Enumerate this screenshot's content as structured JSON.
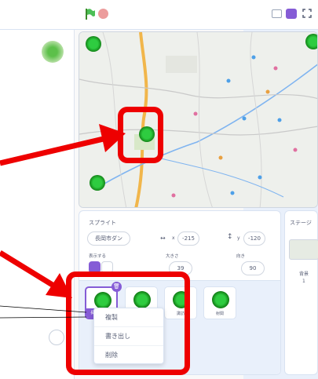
{
  "toolbar": {
    "flag": "green-flag-icon",
    "stop": "stop-icon"
  },
  "sprite_panel": {
    "section_label": "スプライト",
    "sprite_name": "長岡市ダン",
    "x_value": "-215",
    "y_value": "-120",
    "show_label": "表示する",
    "size_label": "大きさ",
    "size_value": "39",
    "direction_label": "向き",
    "direction_value": "90"
  },
  "stage_panel": {
    "title": "ステージ",
    "backdrop_label": "背景",
    "backdrop_count": "1"
  },
  "sprites": [
    {
      "label": "長岡",
      "selected": true
    },
    {
      "label": "",
      "selected": false
    },
    {
      "label": "諏訪",
      "selected": false
    },
    {
      "label": "射関",
      "selected": false
    }
  ],
  "context_menu": [
    "複製",
    "書き出し",
    "削除"
  ],
  "colors": {
    "highlight": "#ee0000",
    "accent": "#855cd6",
    "marker": "#1a9e1a"
  }
}
